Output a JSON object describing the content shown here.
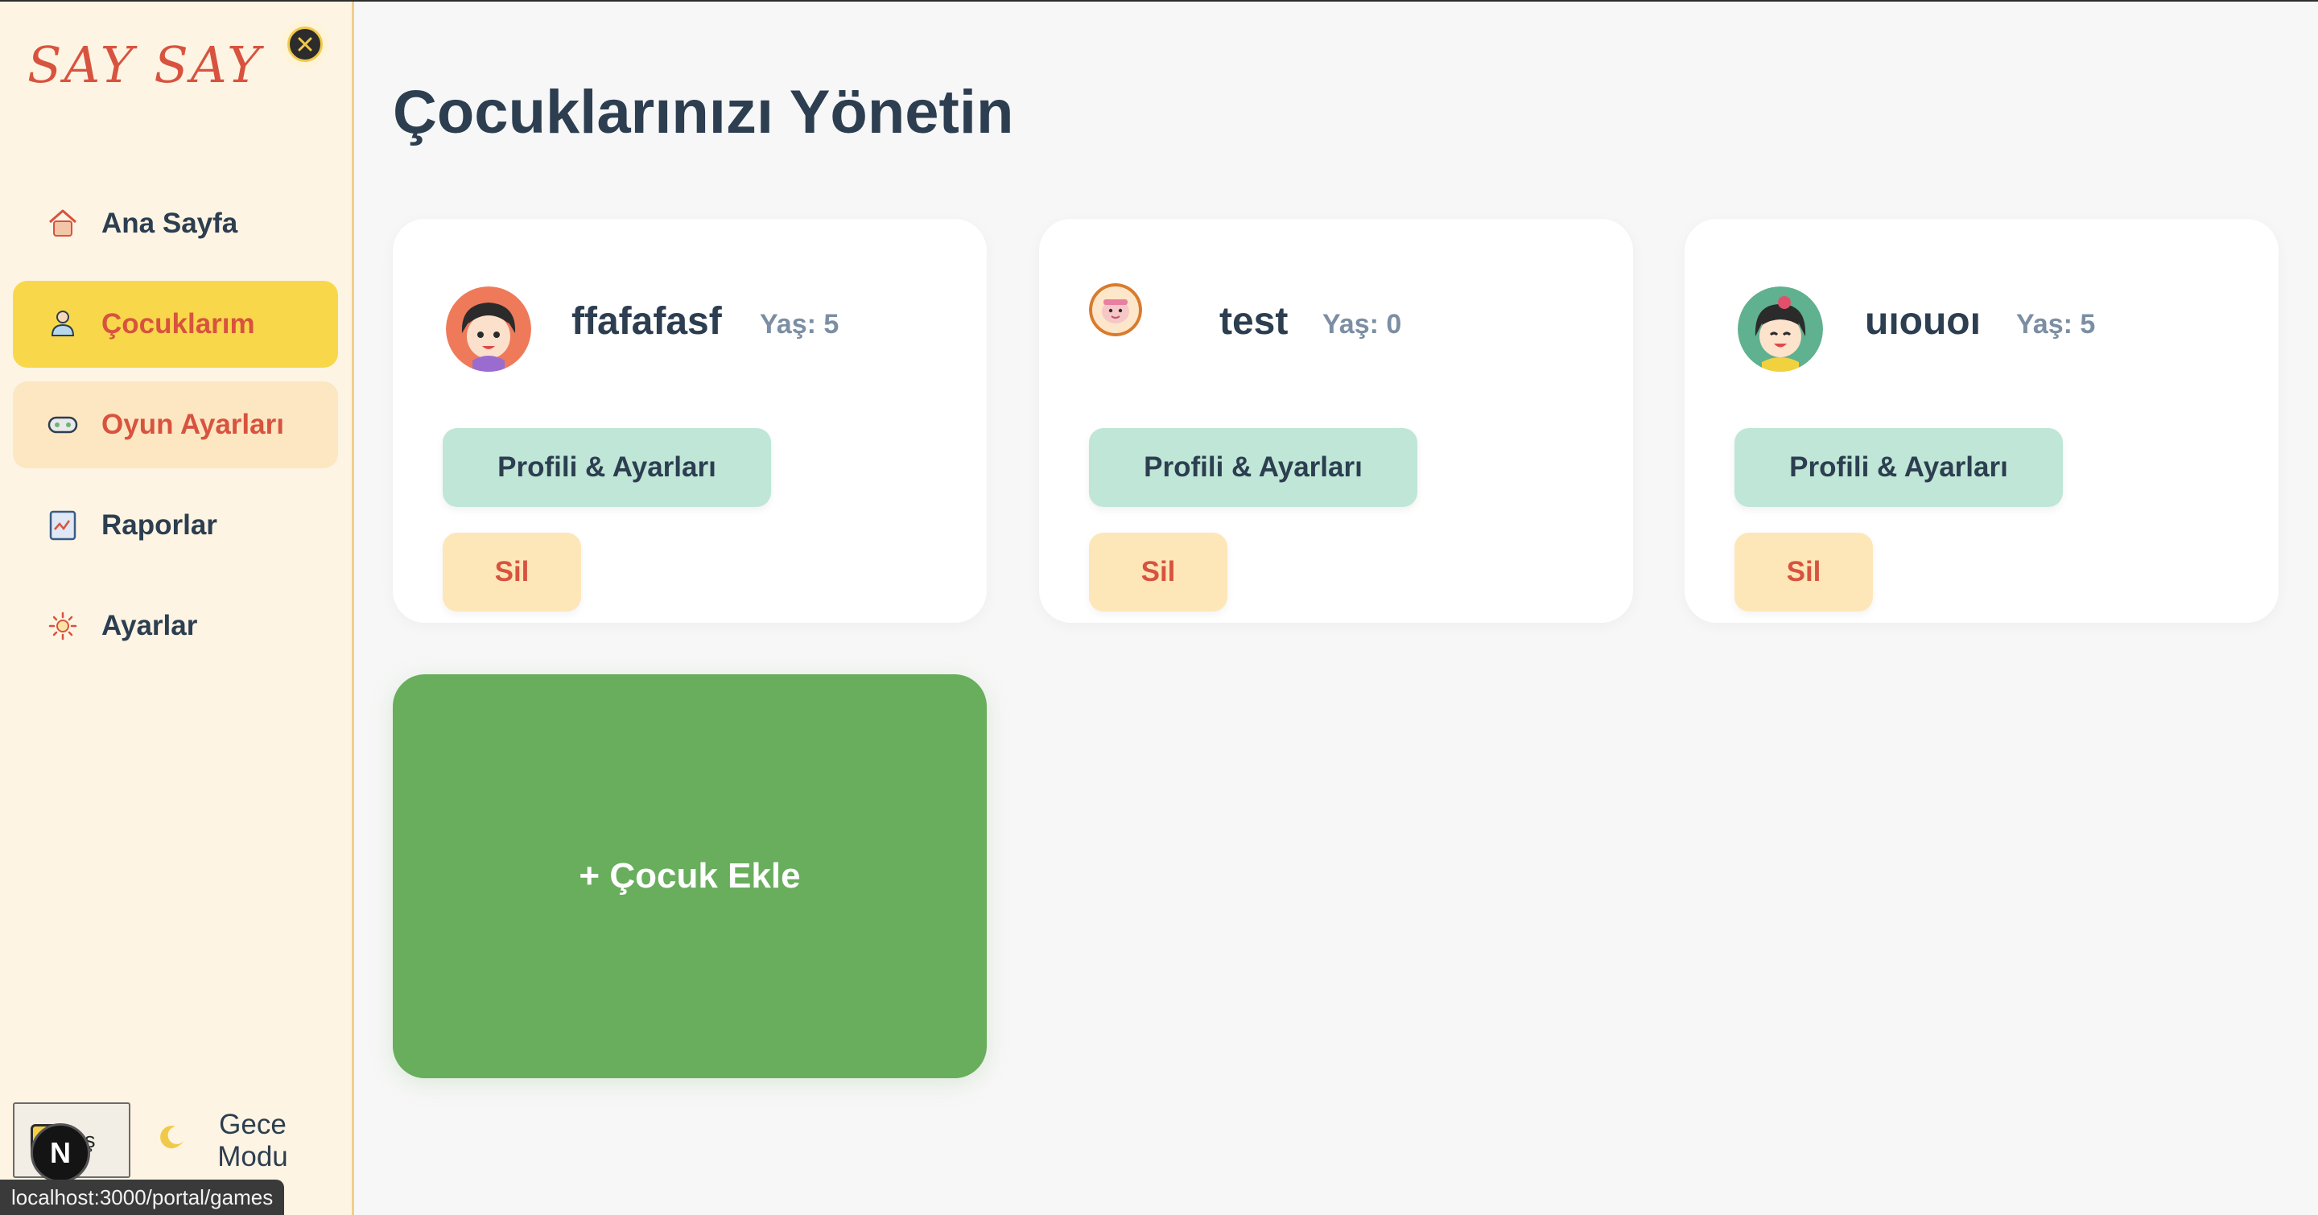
{
  "sidebar": {
    "logo": "SAY SAY",
    "items": [
      {
        "label": "Ana Sayfa",
        "icon": "home-icon"
      },
      {
        "label": "Çocuklarım",
        "icon": "child-icon"
      },
      {
        "label": "Oyun Ayarları",
        "icon": "gamepad-icon"
      },
      {
        "label": "Raporlar",
        "icon": "report-icon"
      },
      {
        "label": "Ayarlar",
        "icon": "gear-icon"
      }
    ],
    "logout_label": "Çıkış",
    "logout_visible": "kış",
    "night_mode_line1": "Gece",
    "night_mode_line2": "Modu",
    "next_badge": "N"
  },
  "status_url": "localhost:3000/portal/games",
  "main": {
    "title": "Çocuklarınızı Yönetin",
    "children": [
      {
        "name": "ffafafasf",
        "age": "Yaş: 5",
        "profile_label": "Profili & Ayarları",
        "delete_label": "Sil"
      },
      {
        "name": "test",
        "age": "Yaş: 0",
        "profile_label": "Profili & Ayarları",
        "delete_label": "Sil"
      },
      {
        "name": "uıouoı",
        "age": "Yaş: 5",
        "profile_label": "Profili & Ayarları",
        "delete_label": "Sil"
      }
    ],
    "add_child_label": "+ Çocuk Ekle"
  },
  "colors": {
    "accent_red": "#d8533f",
    "active_yellow": "#f8d84a",
    "sidebar_bg": "#fdf4e3",
    "add_green": "#68ae5c",
    "profile_btn": "#bfe6d6",
    "delete_btn": "#fde7b9",
    "text_dark": "#2c3e50"
  }
}
